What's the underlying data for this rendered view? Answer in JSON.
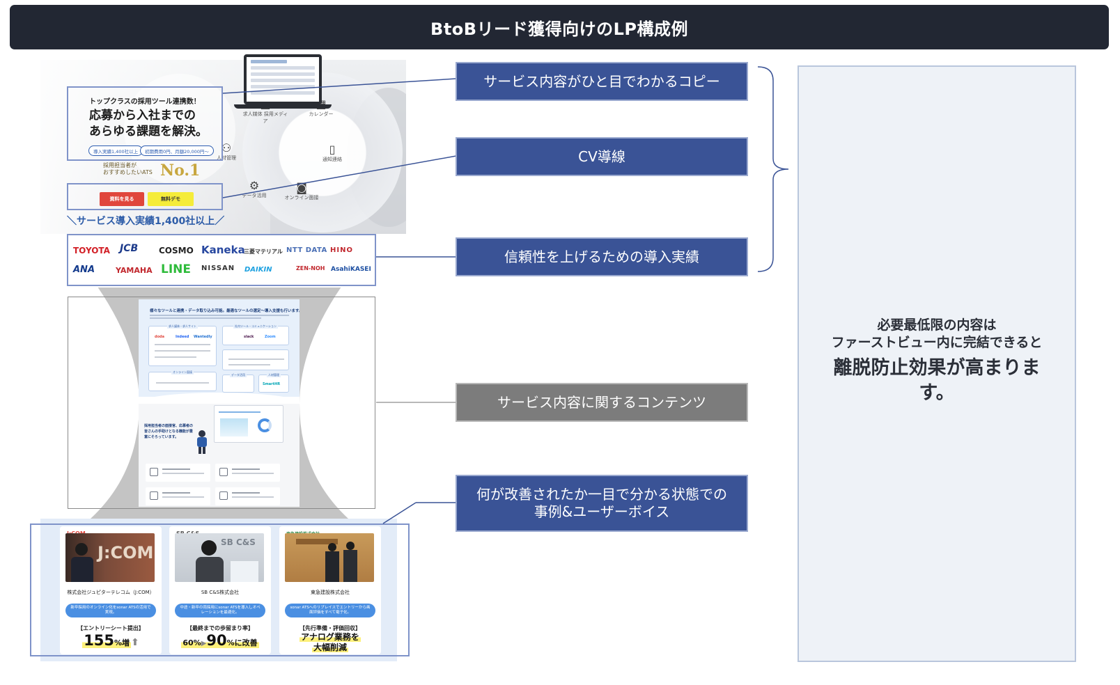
{
  "title": "BtoBリード獲得向けのLP構成例",
  "hero": {
    "small_copy": "トップクラスの採用ツール連携数！",
    "main_copy_line1": "応募から入社までの",
    "main_copy_line2": "あらゆる課題を解決。",
    "pill1": "導入実績1,400社以上",
    "pill2": "初期費用0円、月額20,000円〜",
    "award_line1": "採用担当者が",
    "award_line2": "おすすめしたいATS",
    "award_no1": "No.1",
    "btn_primary": "資料を見る",
    "btn_secondary": "無料デモ",
    "wheel_items": [
      "求人媒体 採用メディア",
      "カレンダー",
      "通知連絡",
      "オンライン面接",
      "データ活用",
      "人材管理"
    ],
    "record_text": "サービス導入実績1,400社以上"
  },
  "logos": [
    "TOYOTA",
    "JCB",
    "COSMO",
    "Kaneka",
    "三菱マテリアル",
    "NTT DATA",
    "HINO",
    "ANA",
    "YAMAHA",
    "LINE",
    "NISSAN",
    "DAIKIN",
    "ZEN-NOH",
    "AsahiKASEI"
  ],
  "content_page": {
    "heading": "様々なツールと連携・データ取り込み可能。最適なツールの選定〜導入支援も行います。",
    "card_caps": [
      "求人媒体・求人サイト",
      "社内ツール・コミュニケーション",
      "オンライン面接",
      "データ活用",
      "人材管理"
    ],
    "mini_logos": [
      "doda",
      "Indeed",
      "Wantedly",
      "slack",
      "Zoom",
      "SmartHR"
    ],
    "feature_copy": "採用担当者の面接官、応募者の皆さんの手助けとなる機能が豊富にそろっています。"
  },
  "cases": [
    {
      "brand": "J:COM",
      "company": "株式会社ジュピターテレコム（J:COM）",
      "bubble": "新卒採用のオンライン化をsonar ATSの活用で実現。",
      "label": "【エントリーシート提出】",
      "result_big": "155",
      "result_small": "%増",
      "brand_color": "#e0463c"
    },
    {
      "brand": "SB C&S",
      "company": "SB C&S株式会社",
      "bubble": "中途・新卒の両採用にsonar ATSを導入しオペレーションを最適化。",
      "label": "【最終までの歩留まり率】",
      "result_pre": "60%",
      "result_big": "90",
      "result_small": "%に改善",
      "brand_color": "#555555"
    },
    {
      "brand": "東急建設株式会社",
      "company": "東急建設株式会社",
      "bubble": "sonar ATSへのリプレイスでエントリーから画面評価をすべて電子化。",
      "label": "【先行準備・評価回収】",
      "result_line1": "アナログ業務を",
      "result_line2": "大幅削減",
      "brand_color": "#3a8a4a"
    }
  ],
  "callouts": {
    "copy": "サービス内容がひと目でわかるコピー",
    "cv": "CV導線",
    "trust": "信頼性を上げるための導入実績",
    "content": "サービス内容に関するコンテンツ",
    "case_line1": "何が改善されたか一目で分かる状態での",
    "case_line2": "事例&ユーザーボイス"
  },
  "summary": {
    "line1": "必要最低限の内容は",
    "line2": "ファーストビュー内に完結できると",
    "emphasis_line1": "離脱防止効果が高まりま",
    "emphasis_line2": "す。"
  },
  "colors": {
    "title_bg": "#222733",
    "callout_blue": "#3a5396",
    "callout_gray": "#7c7c7c",
    "highlight_border": "#7f93c9",
    "summary_bg": "#eef2f7"
  }
}
